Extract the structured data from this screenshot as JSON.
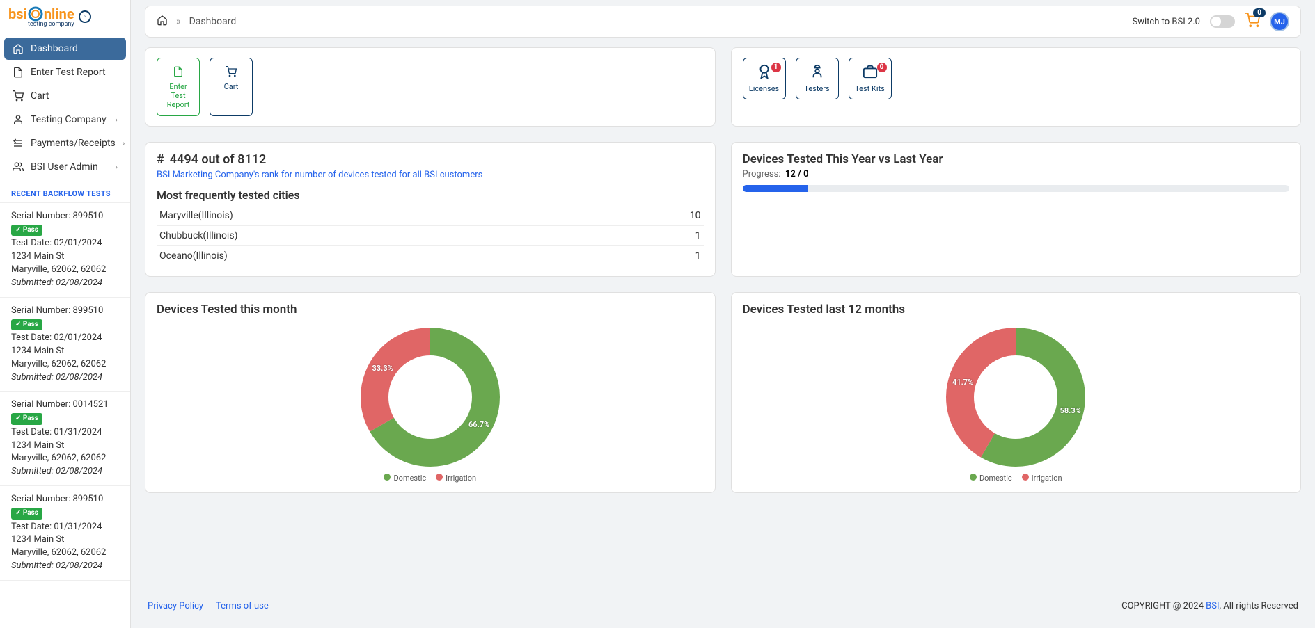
{
  "brand": {
    "name_1": "bsi",
    "name_2": "nline",
    "sub": "testing company"
  },
  "nav": {
    "items": [
      {
        "label": "Dashboard",
        "icon": "home",
        "active": true,
        "chev": false
      },
      {
        "label": "Enter Test Report",
        "icon": "file",
        "active": false,
        "chev": false
      },
      {
        "label": "Cart",
        "icon": "cart",
        "active": false,
        "chev": false
      },
      {
        "label": "Testing Company",
        "icon": "user",
        "active": false,
        "chev": true
      },
      {
        "label": "Payments/Receipts",
        "icon": "receipt",
        "active": false,
        "chev": true
      },
      {
        "label": "BSI User Admin",
        "icon": "users",
        "active": false,
        "chev": true
      }
    ]
  },
  "recent": {
    "header": "RECENT BACKFLOW TESTS",
    "items": [
      {
        "serial": "Serial Number: 899510",
        "status": "Pass",
        "date": "Test Date: 02/01/2024",
        "addr1": "1234 Main St",
        "addr2": "Maryville, 62062, 62062",
        "sub": "Submitted: 02/08/2024"
      },
      {
        "serial": "Serial Number: 899510",
        "status": "Pass",
        "date": "Test Date: 02/01/2024",
        "addr1": "1234 Main St",
        "addr2": "Maryville, 62062, 62062",
        "sub": "Submitted: 02/08/2024"
      },
      {
        "serial": "Serial Number: 0014521",
        "status": "Pass",
        "date": "Test Date: 01/31/2024",
        "addr1": "1234 Main St",
        "addr2": "Maryville, 62062, 62062",
        "sub": "Submitted: 02/08/2024"
      },
      {
        "serial": "Serial Number: 899510",
        "status": "Pass",
        "date": "Test Date: 01/31/2024",
        "addr1": "1234 Main St",
        "addr2": "Maryville, 62062, 62062",
        "sub": "Submitted: 02/08/2024"
      }
    ]
  },
  "topbar": {
    "crumb": "Dashboard",
    "switch": "Switch to BSI 2.0",
    "cart_count": "0",
    "avatar": "MJ"
  },
  "actions_left": [
    {
      "label": "Enter Test Report",
      "color": "green",
      "icon": "file"
    },
    {
      "label": "Cart",
      "color": "blue",
      "icon": "cart"
    }
  ],
  "actions_right": [
    {
      "label": "Licenses",
      "icon": "license",
      "badge": "1"
    },
    {
      "label": "Testers",
      "icon": "tester"
    },
    {
      "label": "Test Kits",
      "icon": "kit",
      "badge": "0"
    }
  ],
  "rank": {
    "text": "4494 out of 8112",
    "sub": "BSI Marketing Company's rank for number of devices tested for all BSI customers",
    "cities_h": "Most frequently tested cities",
    "cities": [
      {
        "name": "Maryville(Illinois)",
        "n": "10"
      },
      {
        "name": "Chubbuck(Illinois)",
        "n": "1"
      },
      {
        "name": "Oceano(Illinois)",
        "n": "1"
      }
    ]
  },
  "progress": {
    "title": "Devices Tested This Year vs Last Year",
    "label": "Progress:",
    "value": "12 / 0",
    "pct": 12
  },
  "chart_month": {
    "title": "Devices Tested this month"
  },
  "chart_year": {
    "title": "Devices Tested last 12 months"
  },
  "legend": {
    "a": "Domestic",
    "b": "Irrigation"
  },
  "footer": {
    "privacy": "Privacy Policy",
    "terms": "Terms of use",
    "copy1": "COPYRIGHT @ 2024 ",
    "brand": "BSI",
    "copy2": ", All rights Reserved"
  },
  "chart_data": [
    {
      "type": "pie",
      "title": "Devices Tested this month",
      "series": [
        {
          "name": "Domestic",
          "value": 66.7,
          "color": "#6aa84f"
        },
        {
          "name": "Irrigation",
          "value": 33.3,
          "color": "#e06666"
        }
      ]
    },
    {
      "type": "pie",
      "title": "Devices Tested last 12 months",
      "series": [
        {
          "name": "Domestic",
          "value": 58.3,
          "color": "#6aa84f"
        },
        {
          "name": "Irrigation",
          "value": 41.7,
          "color": "#e06666"
        }
      ]
    }
  ]
}
